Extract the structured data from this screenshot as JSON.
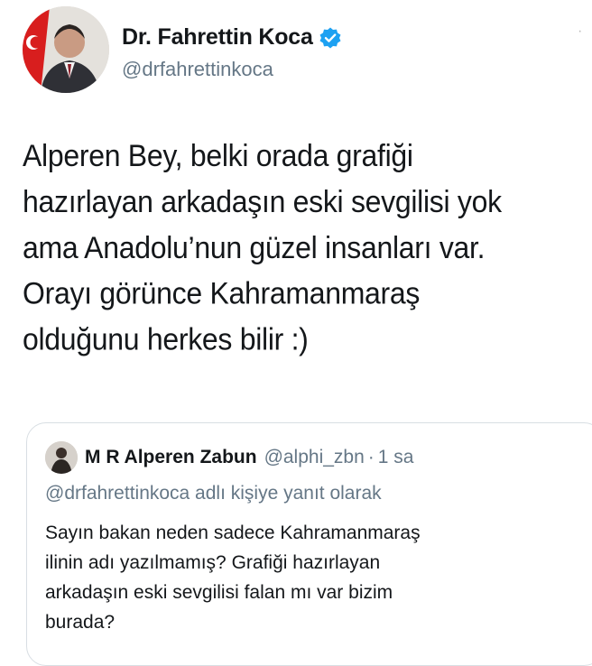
{
  "tweet": {
    "author_name": "Dr. Fahrettin Koca",
    "author_handle": "@drfahrettinkoca",
    "text_lines": [
      "Alperen Bey, belki orada grafiği",
      "hazırlayan arkadaşın eski sevgilisi yok",
      "ama Anadolu’nun güzel insanları var.",
      "Orayı görünce Kahramanmaraş",
      "olduğunu herkes bilir :)"
    ],
    "verified_icon": "verified-badge-icon",
    "colors": {
      "verified": "#1da1f2",
      "secondary_text": "#657786"
    }
  },
  "quoted": {
    "author_name": "M R Alperen Zabun",
    "author_handle": "@alphi_zbn",
    "separator": "·",
    "time": "1 sa",
    "reply_context": "@drfahrettinkoca adlı kişiye yanıt olarak",
    "text_lines": [
      "Sayın bakan neden sadece Kahramanmaraş",
      "ilinin adı yazılmamış? Grafiği hazırlayan",
      "arkadaşın eski sevgilisi falan mı var bizim",
      "burada?"
    ]
  }
}
